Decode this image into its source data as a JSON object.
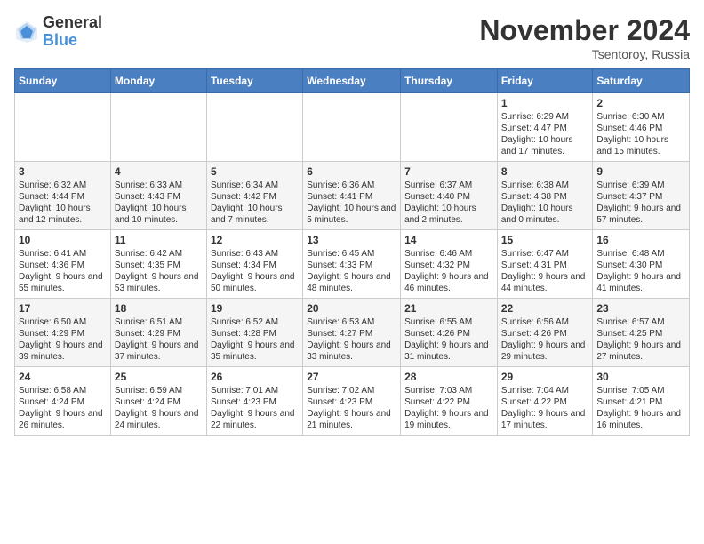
{
  "logo": {
    "general": "General",
    "blue": "Blue"
  },
  "title": "November 2024",
  "location": "Tsentoroy, Russia",
  "days_of_week": [
    "Sunday",
    "Monday",
    "Tuesday",
    "Wednesday",
    "Thursday",
    "Friday",
    "Saturday"
  ],
  "weeks": [
    [
      {
        "day": "",
        "sunrise": "",
        "sunset": "",
        "daylight": ""
      },
      {
        "day": "",
        "sunrise": "",
        "sunset": "",
        "daylight": ""
      },
      {
        "day": "",
        "sunrise": "",
        "sunset": "",
        "daylight": ""
      },
      {
        "day": "",
        "sunrise": "",
        "sunset": "",
        "daylight": ""
      },
      {
        "day": "",
        "sunrise": "",
        "sunset": "",
        "daylight": ""
      },
      {
        "day": "1",
        "sunrise": "Sunrise: 6:29 AM",
        "sunset": "Sunset: 4:47 PM",
        "daylight": "Daylight: 10 hours and 17 minutes."
      },
      {
        "day": "2",
        "sunrise": "Sunrise: 6:30 AM",
        "sunset": "Sunset: 4:46 PM",
        "daylight": "Daylight: 10 hours and 15 minutes."
      }
    ],
    [
      {
        "day": "3",
        "sunrise": "Sunrise: 6:32 AM",
        "sunset": "Sunset: 4:44 PM",
        "daylight": "Daylight: 10 hours and 12 minutes."
      },
      {
        "day": "4",
        "sunrise": "Sunrise: 6:33 AM",
        "sunset": "Sunset: 4:43 PM",
        "daylight": "Daylight: 10 hours and 10 minutes."
      },
      {
        "day": "5",
        "sunrise": "Sunrise: 6:34 AM",
        "sunset": "Sunset: 4:42 PM",
        "daylight": "Daylight: 10 hours and 7 minutes."
      },
      {
        "day": "6",
        "sunrise": "Sunrise: 6:36 AM",
        "sunset": "Sunset: 4:41 PM",
        "daylight": "Daylight: 10 hours and 5 minutes."
      },
      {
        "day": "7",
        "sunrise": "Sunrise: 6:37 AM",
        "sunset": "Sunset: 4:40 PM",
        "daylight": "Daylight: 10 hours and 2 minutes."
      },
      {
        "day": "8",
        "sunrise": "Sunrise: 6:38 AM",
        "sunset": "Sunset: 4:38 PM",
        "daylight": "Daylight: 10 hours and 0 minutes."
      },
      {
        "day": "9",
        "sunrise": "Sunrise: 6:39 AM",
        "sunset": "Sunset: 4:37 PM",
        "daylight": "Daylight: 9 hours and 57 minutes."
      }
    ],
    [
      {
        "day": "10",
        "sunrise": "Sunrise: 6:41 AM",
        "sunset": "Sunset: 4:36 PM",
        "daylight": "Daylight: 9 hours and 55 minutes."
      },
      {
        "day": "11",
        "sunrise": "Sunrise: 6:42 AM",
        "sunset": "Sunset: 4:35 PM",
        "daylight": "Daylight: 9 hours and 53 minutes."
      },
      {
        "day": "12",
        "sunrise": "Sunrise: 6:43 AM",
        "sunset": "Sunset: 4:34 PM",
        "daylight": "Daylight: 9 hours and 50 minutes."
      },
      {
        "day": "13",
        "sunrise": "Sunrise: 6:45 AM",
        "sunset": "Sunset: 4:33 PM",
        "daylight": "Daylight: 9 hours and 48 minutes."
      },
      {
        "day": "14",
        "sunrise": "Sunrise: 6:46 AM",
        "sunset": "Sunset: 4:32 PM",
        "daylight": "Daylight: 9 hours and 46 minutes."
      },
      {
        "day": "15",
        "sunrise": "Sunrise: 6:47 AM",
        "sunset": "Sunset: 4:31 PM",
        "daylight": "Daylight: 9 hours and 44 minutes."
      },
      {
        "day": "16",
        "sunrise": "Sunrise: 6:48 AM",
        "sunset": "Sunset: 4:30 PM",
        "daylight": "Daylight: 9 hours and 41 minutes."
      }
    ],
    [
      {
        "day": "17",
        "sunrise": "Sunrise: 6:50 AM",
        "sunset": "Sunset: 4:29 PM",
        "daylight": "Daylight: 9 hours and 39 minutes."
      },
      {
        "day": "18",
        "sunrise": "Sunrise: 6:51 AM",
        "sunset": "Sunset: 4:29 PM",
        "daylight": "Daylight: 9 hours and 37 minutes."
      },
      {
        "day": "19",
        "sunrise": "Sunrise: 6:52 AM",
        "sunset": "Sunset: 4:28 PM",
        "daylight": "Daylight: 9 hours and 35 minutes."
      },
      {
        "day": "20",
        "sunrise": "Sunrise: 6:53 AM",
        "sunset": "Sunset: 4:27 PM",
        "daylight": "Daylight: 9 hours and 33 minutes."
      },
      {
        "day": "21",
        "sunrise": "Sunrise: 6:55 AM",
        "sunset": "Sunset: 4:26 PM",
        "daylight": "Daylight: 9 hours and 31 minutes."
      },
      {
        "day": "22",
        "sunrise": "Sunrise: 6:56 AM",
        "sunset": "Sunset: 4:26 PM",
        "daylight": "Daylight: 9 hours and 29 minutes."
      },
      {
        "day": "23",
        "sunrise": "Sunrise: 6:57 AM",
        "sunset": "Sunset: 4:25 PM",
        "daylight": "Daylight: 9 hours and 27 minutes."
      }
    ],
    [
      {
        "day": "24",
        "sunrise": "Sunrise: 6:58 AM",
        "sunset": "Sunset: 4:24 PM",
        "daylight": "Daylight: 9 hours and 26 minutes."
      },
      {
        "day": "25",
        "sunrise": "Sunrise: 6:59 AM",
        "sunset": "Sunset: 4:24 PM",
        "daylight": "Daylight: 9 hours and 24 minutes."
      },
      {
        "day": "26",
        "sunrise": "Sunrise: 7:01 AM",
        "sunset": "Sunset: 4:23 PM",
        "daylight": "Daylight: 9 hours and 22 minutes."
      },
      {
        "day": "27",
        "sunrise": "Sunrise: 7:02 AM",
        "sunset": "Sunset: 4:23 PM",
        "daylight": "Daylight: 9 hours and 21 minutes."
      },
      {
        "day": "28",
        "sunrise": "Sunrise: 7:03 AM",
        "sunset": "Sunset: 4:22 PM",
        "daylight": "Daylight: 9 hours and 19 minutes."
      },
      {
        "day": "29",
        "sunrise": "Sunrise: 7:04 AM",
        "sunset": "Sunset: 4:22 PM",
        "daylight": "Daylight: 9 hours and 17 minutes."
      },
      {
        "day": "30",
        "sunrise": "Sunrise: 7:05 AM",
        "sunset": "Sunset: 4:21 PM",
        "daylight": "Daylight: 9 hours and 16 minutes."
      }
    ]
  ]
}
